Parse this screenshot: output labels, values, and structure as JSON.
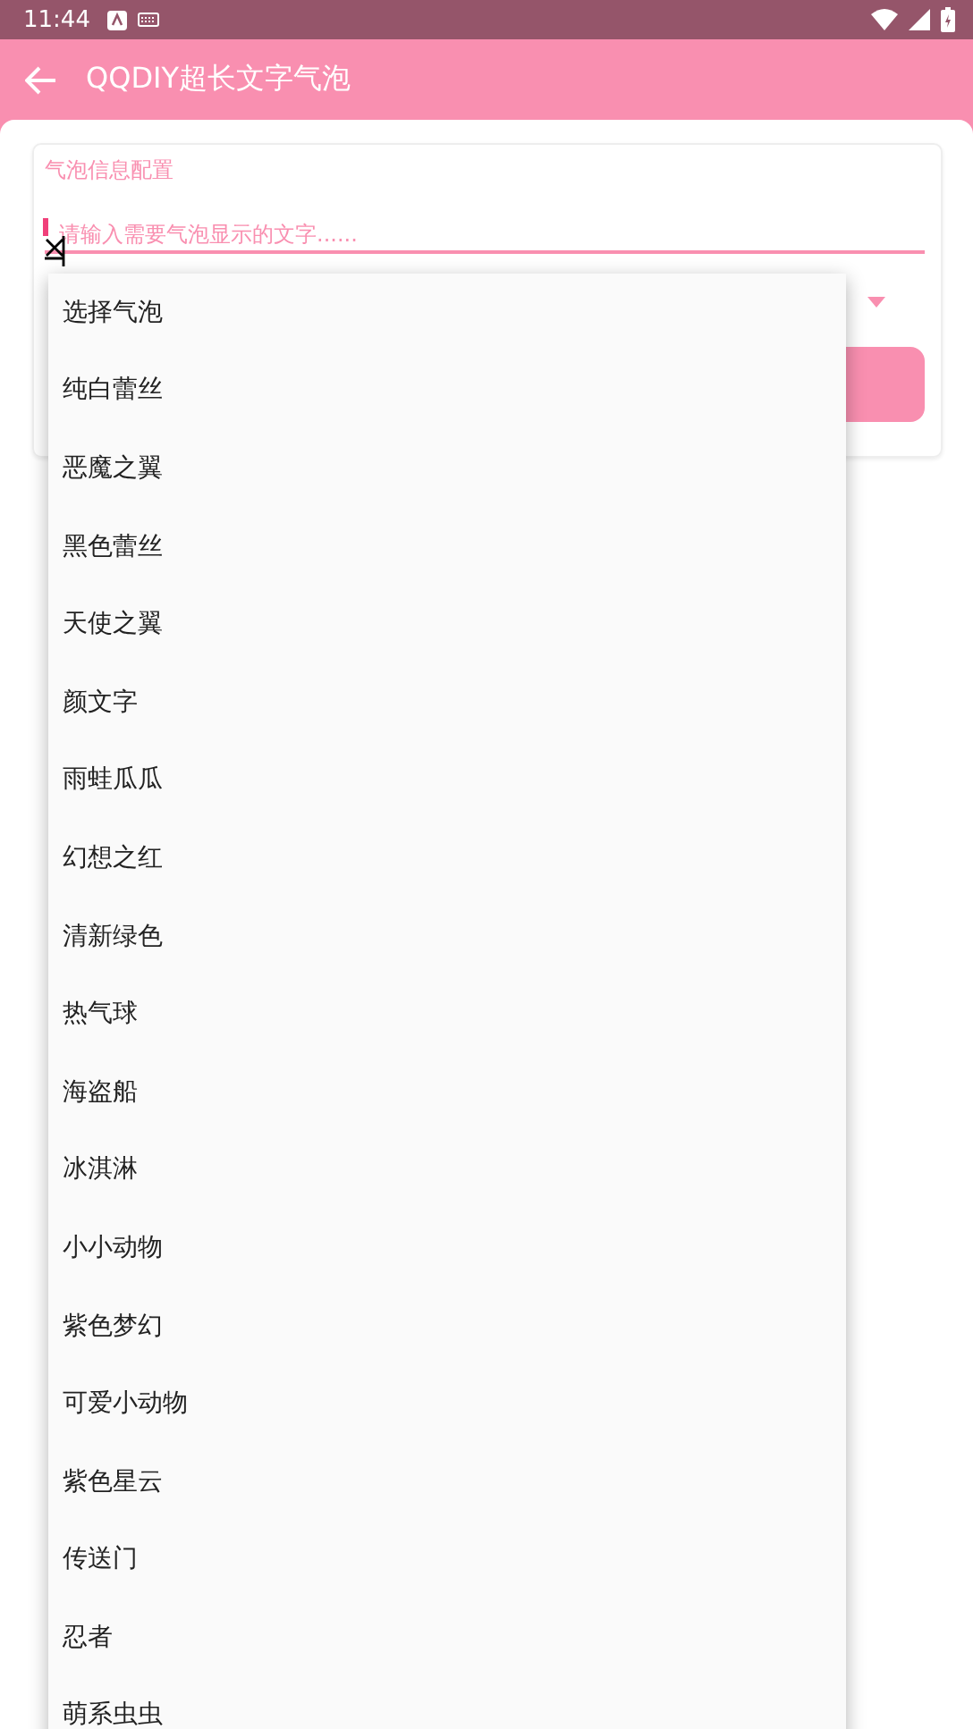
{
  "status_bar": {
    "time": "11:44"
  },
  "app_bar": {
    "title": "QQDIY超长文字气泡"
  },
  "card": {
    "title": "气泡信息配置",
    "input": {
      "placeholder": "请输入需要气泡显示的文字......"
    }
  },
  "dropdown": {
    "items": [
      "选择气泡",
      "纯白蕾丝",
      "恶魔之翼",
      "黑色蕾丝",
      "天使之翼",
      "颜文字",
      "雨蛙瓜瓜",
      "幻想之红",
      "清新绿色",
      "热气球",
      "海盗船",
      "冰淇淋",
      "小小动物",
      "紫色梦幻",
      "可爱小动物",
      "紫色星云",
      "传送门",
      "忍者",
      "萌系虫虫"
    ]
  }
}
